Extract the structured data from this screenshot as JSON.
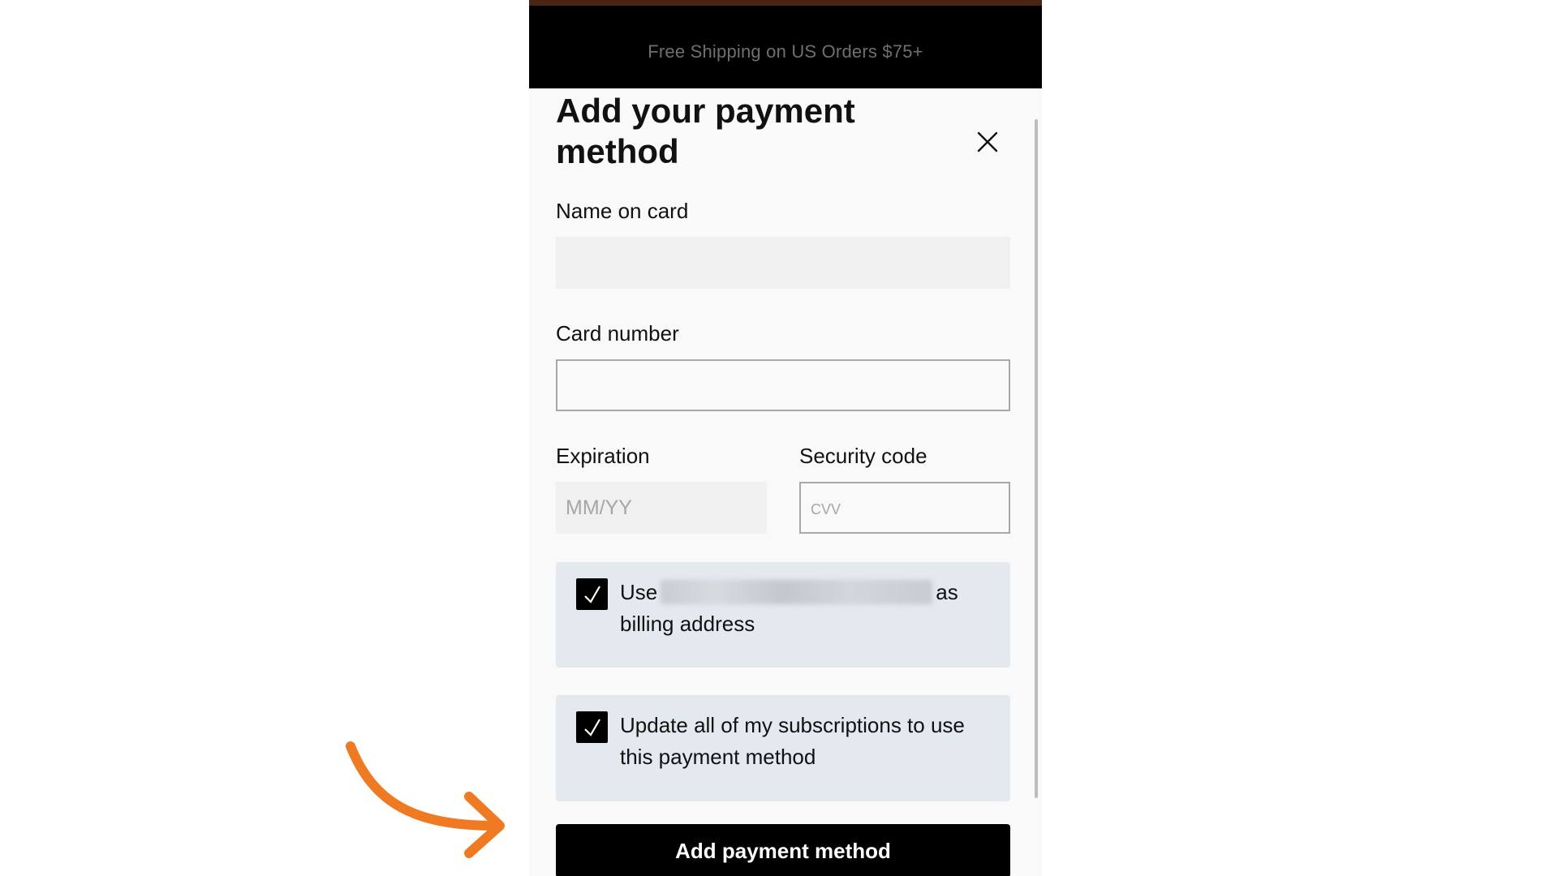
{
  "promo_banner": {
    "text": "Free Shipping on US Orders $75+"
  },
  "dialog": {
    "title": "Add your payment method",
    "fields": {
      "name_on_card": {
        "label": "Name on card",
        "value": "",
        "placeholder": ""
      },
      "card_number": {
        "label": "Card number",
        "value": "",
        "placeholder": ""
      },
      "expiration": {
        "label": "Expiration",
        "value": "",
        "placeholder": "MM/YY"
      },
      "security_code": {
        "label": "Security code",
        "value": "",
        "placeholder": "CVV"
      }
    },
    "billing_option": {
      "checked": true,
      "prefix": "Use",
      "suffix": "as billing address"
    },
    "subscriptions_option": {
      "checked": true,
      "text": "Update all of my subscriptions to use this payment method"
    },
    "submit_label": "Add payment method"
  },
  "colors": {
    "accent_arrow": "#f07a22",
    "checkbox": "#000000",
    "option_background": "#e4e8ef",
    "button": "#000000"
  },
  "icons": {
    "close": "close-icon",
    "check": "checkmark-icon",
    "annotation": "curved-arrow-icon"
  }
}
